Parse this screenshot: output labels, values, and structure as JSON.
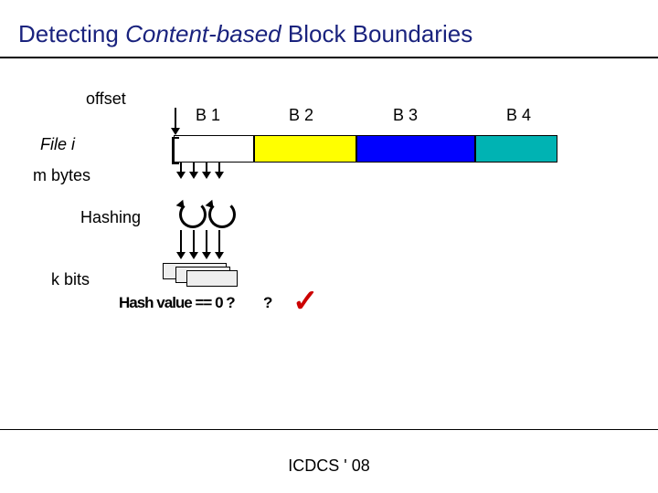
{
  "title_pre": "Detecting ",
  "title_italic": "Content-based",
  "title_post": " Block Boundaries",
  "labels": {
    "offset": "offset",
    "file": "File i",
    "mbytes": "m bytes",
    "hashing": "Hashing",
    "kbits": "k bits"
  },
  "blocks": [
    "B 1",
    "B 2",
    "B 3",
    "B 4"
  ],
  "query_text": "Hash value == 0 ?",
  "check": "✓",
  "footer": "ICDCS ' 08"
}
